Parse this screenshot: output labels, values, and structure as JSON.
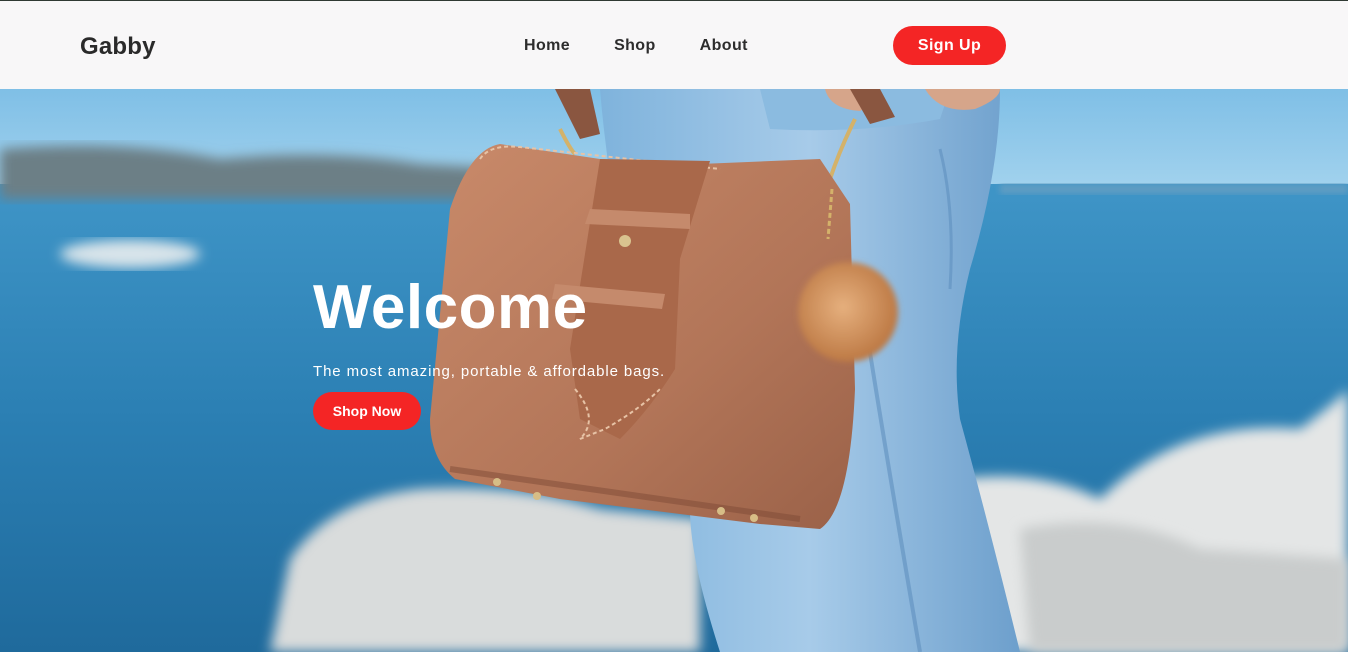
{
  "brand": {
    "name": "Gabby"
  },
  "nav": {
    "items": [
      {
        "label": "Home"
      },
      {
        "label": "Shop"
      },
      {
        "label": "About"
      }
    ],
    "signup_label": "Sign Up"
  },
  "hero": {
    "title": "Welcome",
    "subtitle": "The most amazing, portable & affordable bags.",
    "cta_label": "Shop Now",
    "image": "woman-holding-brown-leather-handbag-by-sea"
  },
  "colors": {
    "accent": "#f42525",
    "navbar_bg": "#f8f7f8",
    "brand_text": "#2a2a2a"
  }
}
